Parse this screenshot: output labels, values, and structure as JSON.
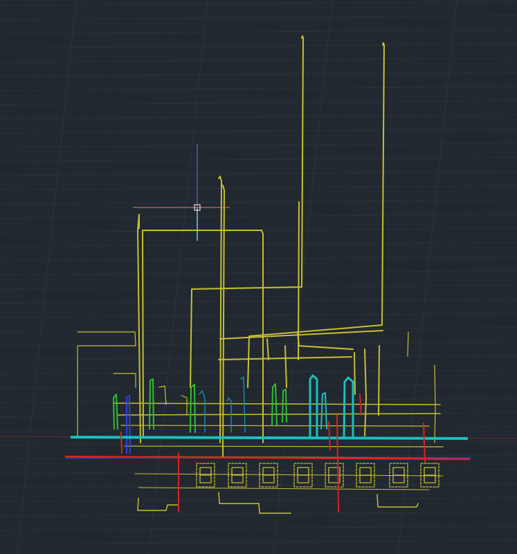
{
  "app": {
    "title": ""
  },
  "colors": {
    "background": "#212830",
    "grid": "#2d3541",
    "pipe_yellow": "#c8c030",
    "pipe_cyan": "#18c0c0",
    "pipe_green": "#30c030",
    "pipe_blue": "#3040e0",
    "pipe_red": "#e02020",
    "pipe_teal": "#2090a0",
    "crosshair_x": "#e08080",
    "crosshair_y": "#7070e0",
    "cursor_box": "#e0e0e0"
  },
  "icons": [
    "crosshair-cursor-icon"
  ]
}
